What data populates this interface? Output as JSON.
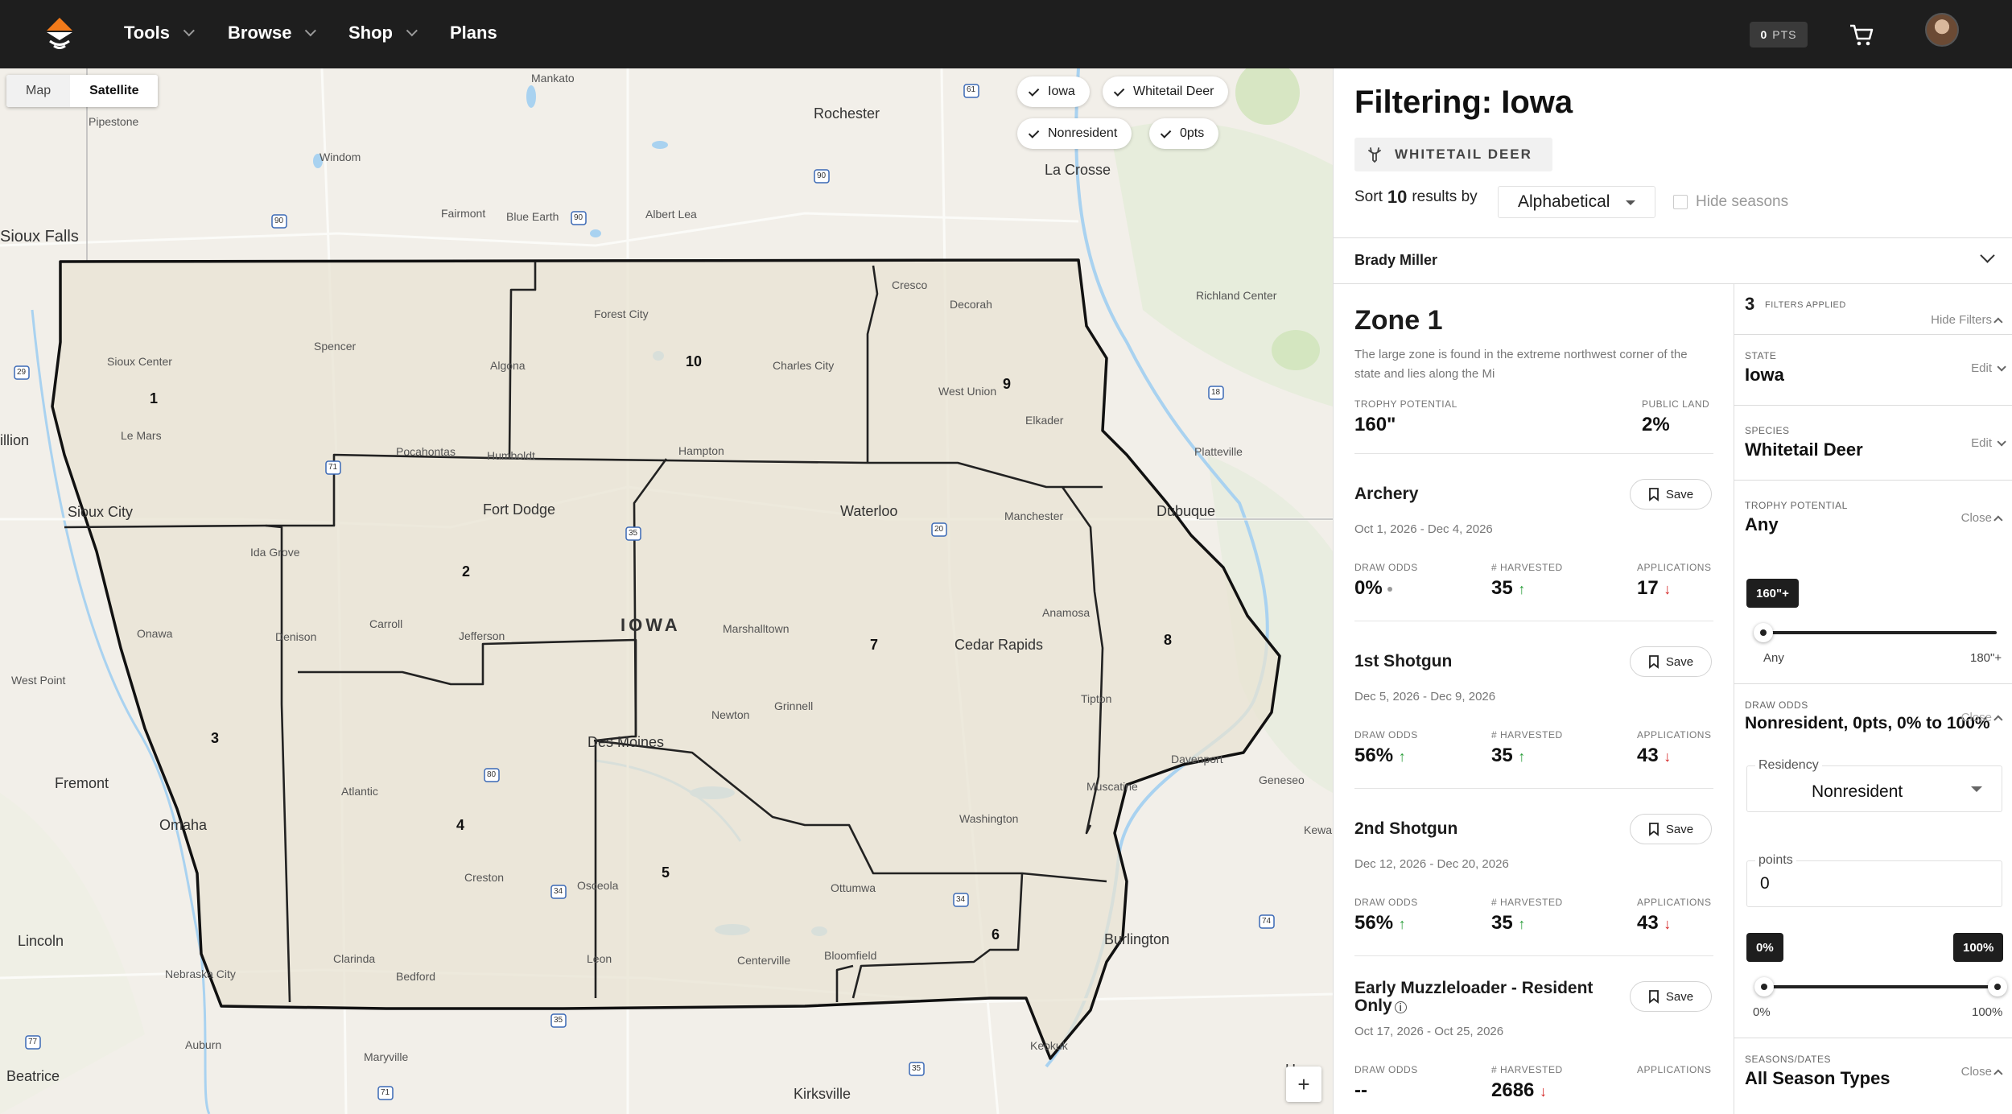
{
  "nav": {
    "items": [
      {
        "label": "Tools",
        "has_menu": true
      },
      {
        "label": "Browse",
        "has_menu": true
      },
      {
        "label": "Shop",
        "has_menu": true
      },
      {
        "label": "Plans",
        "has_menu": false
      }
    ],
    "points_value": "0",
    "points_unit": "PTS"
  },
  "map": {
    "toggle": {
      "map_label": "Map",
      "satellite_label": "Satellite",
      "active": "Satellite"
    },
    "chips": [
      "Iowa",
      "Whitetail Deer",
      "Nonresident",
      "0pts"
    ],
    "state_label": "IOWA",
    "zoom_in": "+",
    "zones": [
      "1",
      "2",
      "3",
      "4",
      "5",
      "6",
      "7",
      "8",
      "9",
      "10"
    ],
    "places": [
      "Mankato",
      "Rochester",
      "La Crosse",
      "Pipestone",
      "Windom",
      "Sioux Falls",
      "Fairmont",
      "Blue Earth",
      "Albert Lea",
      "Cresco",
      "Decorah",
      "Richland Center",
      "Forest City",
      "Sioux Center",
      "Spencer",
      "Algona",
      "Charles City",
      "West Union",
      "Elkader",
      "Le Mars",
      "Pocahontas",
      "Humboldt",
      "Hampton",
      "Platteville",
      "Sioux City",
      "Fort Dodge",
      "Waterloo",
      "Manchester",
      "Dubuque",
      "Ida Grove",
      "Onawa",
      "Denison",
      "Carroll",
      "Jefferson",
      "Marshalltown",
      "Anamosa",
      "Cedar Rapids",
      "West Point",
      "Newton",
      "Grinnell",
      "Tipton",
      "Des Moines",
      "Davenport",
      "Geneseo",
      "Fremont",
      "Omaha",
      "Atlantic",
      "Muscatine",
      "Washington",
      "Creston",
      "Osceola",
      "Ottumwa",
      "Kewan",
      "Lincoln",
      "Clarinda",
      "Bedford",
      "Leon",
      "Centerville",
      "Bloomfield",
      "Burlington",
      "Nebraska City",
      "Auburn",
      "Maryville",
      "Keokuk",
      "Beatrice",
      "Kirksville",
      "illion",
      "H"
    ],
    "highway_shields": [
      "61",
      "90",
      "90",
      "90",
      "29",
      "71",
      "35",
      "20",
      "18",
      "80",
      "34",
      "34",
      "74",
      "77",
      "35",
      "71",
      "35"
    ]
  },
  "panel": {
    "title": "Filtering: Iowa",
    "species_tag": "WHITETAIL DEER",
    "sort": {
      "prefix": "Sort",
      "count": "10",
      "suffix": "results by",
      "selected": "Alphabetical"
    },
    "hide_seasons_label": "Hide seasons",
    "user_name": "Brady Miller"
  },
  "zone": {
    "title": "Zone 1",
    "description": "The large zone is found in the extreme northwest corner of the state and lies along the Mi",
    "trophy_label": "TROPHY POTENTIAL",
    "trophy_value": "160\"",
    "public_label": "PUBLIC LAND",
    "public_value": "2%",
    "save_label": "Save",
    "labels": {
      "odds": "DRAW ODDS",
      "harvested": "# HARVESTED",
      "apps": "APPLICATIONS"
    },
    "seasons": [
      {
        "name": "Archery",
        "dates": "Oct 1, 2026 - Dec 4, 2026",
        "odds": "0%",
        "odds_trend": "neutral",
        "harvested": "35",
        "harvested_trend": "up",
        "apps": "17",
        "apps_trend": "down"
      },
      {
        "name": "1st Shotgun",
        "dates": "Dec 5, 2026 - Dec 9, 2026",
        "odds": "56%",
        "odds_trend": "up",
        "harvested": "35",
        "harvested_trend": "up",
        "apps": "43",
        "apps_trend": "down"
      },
      {
        "name": "2nd Shotgun",
        "dates": "Dec 12, 2026 - Dec 20, 2026",
        "odds": "56%",
        "odds_trend": "up",
        "harvested": "35",
        "harvested_trend": "up",
        "apps": "43",
        "apps_trend": "down"
      },
      {
        "name": "Early Muzzleloader - Resident Only",
        "dates": "Oct 17, 2026 - Oct 25, 2026",
        "odds": "--",
        "odds_trend": "none",
        "harvested": "2686",
        "harvested_trend": "down",
        "apps": "",
        "apps_trend": "none"
      }
    ]
  },
  "filters": {
    "count": "3",
    "count_label": "FILTERS APPLIED",
    "hide_label": "Hide Filters",
    "state": {
      "label": "STATE",
      "value": "Iowa",
      "action": "Edit"
    },
    "species": {
      "label": "SPECIES",
      "value": "Whitetail Deer",
      "action": "Edit"
    },
    "trophy": {
      "label": "TROPHY POTENTIAL",
      "value": "Any",
      "action": "Close",
      "tooltip": "160\"+",
      "min_label": "Any",
      "max_label": "180\"+",
      "slider_fraction": 0
    },
    "draw_odds": {
      "label": "DRAW ODDS",
      "value": "Nonresident, 0pts, 0% to 100%",
      "action": "Close",
      "residency_label": "Residency",
      "residency_value": "Nonresident",
      "points_label": "points",
      "points_value": "0",
      "low_tooltip": "0%",
      "high_tooltip": "100%",
      "min_label": "0%",
      "max_label": "100%",
      "low_fraction": 0,
      "high_fraction": 1
    },
    "seasons": {
      "label": "SEASONS/DATES",
      "value": "All Season Types",
      "action": "Close"
    }
  }
}
